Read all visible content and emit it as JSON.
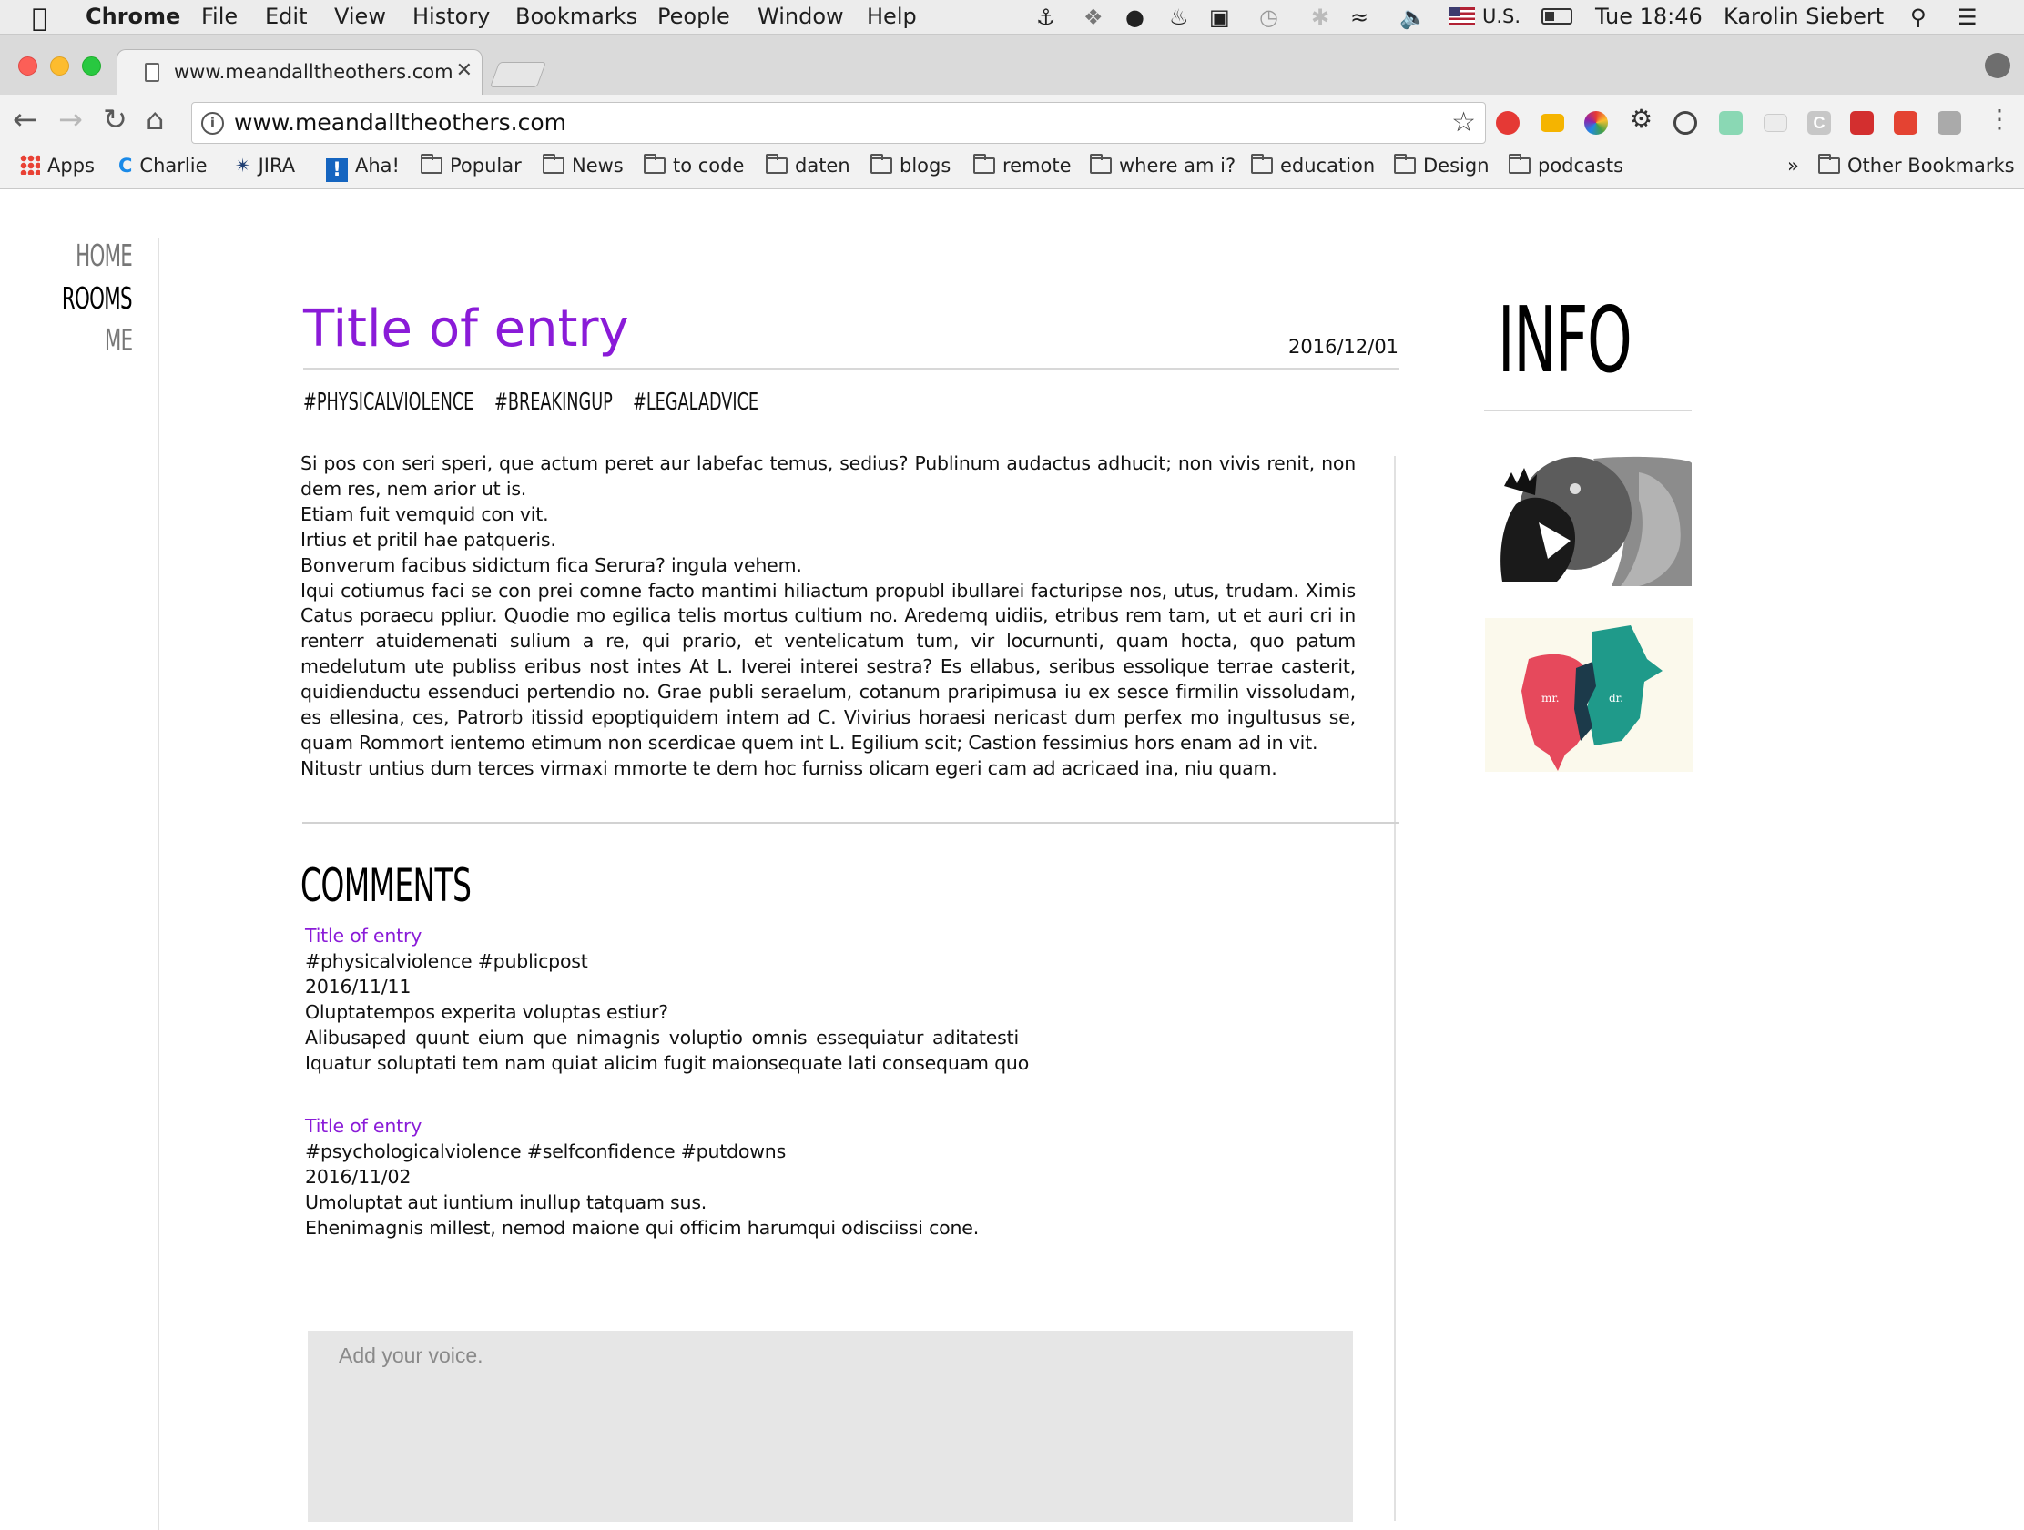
{
  "menubar": {
    "app_name": "Chrome",
    "menus": [
      "File",
      "Edit",
      "View",
      "History",
      "Bookmarks",
      "People",
      "Window",
      "Help"
    ],
    "input_source": "U.S.",
    "clock": "Tue 18:46",
    "user": "Karolin Siebert",
    "status_icons": [
      "docker-icon",
      "dropbox-icon",
      "evernote-icon",
      "flame-icon",
      "display-icon",
      "time-machine-icon",
      "bluetooth-icon",
      "wifi-icon",
      "volume-icon",
      "flag-icon",
      "battery-icon"
    ]
  },
  "browser": {
    "tab_title": "www.meandalltheothers.com",
    "url": "www.meandalltheothers.com",
    "extensions": [
      "adblock-icon",
      "keyboard-maestro-icon",
      "color-picker-icon",
      "gear-icon",
      "sync-icon",
      "sound-icon",
      "blank-icon",
      "c-icon",
      "lastpass-icon",
      "todoist-icon",
      "camera-icon"
    ]
  },
  "bookmarks": {
    "items": [
      {
        "label": "Apps",
        "icon": "apps-grid-icon"
      },
      {
        "label": "Charlie",
        "icon": "charlie-icon"
      },
      {
        "label": "JIRA",
        "icon": "jira-icon"
      },
      {
        "label": "Aha!",
        "icon": "aha-icon"
      },
      {
        "label": "Popular",
        "icon": "folder-icon"
      },
      {
        "label": "News",
        "icon": "folder-icon"
      },
      {
        "label": "to code",
        "icon": "folder-icon"
      },
      {
        "label": "daten",
        "icon": "folder-icon"
      },
      {
        "label": "blogs",
        "icon": "folder-icon"
      },
      {
        "label": "remote",
        "icon": "folder-icon"
      },
      {
        "label": "where am i?",
        "icon": "folder-icon"
      },
      {
        "label": "education",
        "icon": "folder-icon"
      },
      {
        "label": "Design",
        "icon": "folder-icon"
      },
      {
        "label": "podcasts",
        "icon": "folder-icon"
      }
    ],
    "overflow": "»",
    "other": "Other Bookmarks"
  },
  "nav": {
    "home": "HOME",
    "rooms": "ROOMS",
    "me": "ME"
  },
  "entry": {
    "title": "Title of entry",
    "date": "2016/12/01",
    "tags": [
      "#PHYSICALVIOLENCE",
      "#BREAKINGUP",
      "#LEGALADVICE"
    ],
    "paragraphs": [
      "Si pos con seri speri, que actum peret aur labefac temus, sedius? Publinum audactus adhucit; non vivis renit, non dem res, nem arior ut is.",
      "Etiam fuit vemquid con vit.",
      "Irtius et pritil hae patqueris.",
      "Bonverum facibus sidictum fica Serura? ingula vehem.",
      "Iqui cotiumus faci se con prei comne facto mantimi hiliactum propubl ibullarei facturipse nos, utus, trudam. Ximis Catus poraecu ppliur. Quodie mo egilica telis mortus cultium no. Aredemq uidiis, etribus rem tam, ut et auri cri in renterr atuidemenati sulium a re, qui prario, et ventelicatum tum, vir locurnunti, quam hocta, quo patum medelutum ute publiss eribus nost intes At L. Iverei interei sestra? Es ellabus, seribus essolique terrae casterit, quidienductu essenduci pertendio no. Grae publi seraelum, cotanum praripimusa iu ex sesce firmilin vissoludam, es ellesina, ces, Patrorb itissid epoptiquidem intem ad C. Vivirius horaesi nericast dum perfex mo ingultusus se, quam Rommort ientemo etimum non scerdicae quem int L. Egilium scit; Castion fessimius hors enam ad in vit.",
      "Nitustr untius dum terces virmaxi mmorte te dem hoc furniss olicam egeri cam ad acricaed ina, niu quam."
    ]
  },
  "comments": {
    "heading": "COMMENTS",
    "items": [
      {
        "title": "Title of entry",
        "tags": "#physicalviolence #publicpost",
        "date": "2016/11/11",
        "lines": [
          "Oluptatempos experita voluptas estiur?",
          "Alibusaped quunt eium que nimagnis voluptio omnis essequiatur aditatesti",
          "Iquatur soluptati tem nam quiat alicim fugit maionsequate lati consequam quo"
        ]
      },
      {
        "title": "Title of entry",
        "tags": "#psychologicalviolence #selfconfidence #putdowns",
        "date": "2016/11/02",
        "lines": [
          "Umoluptat aut iuntium inullup tatquam sus.",
          "Ehenimagnis millest, nemod maione qui officim harumqui odisciissi cone."
        ]
      }
    ],
    "input_placeholder": "Add your voice.",
    "input_value": ""
  },
  "sidebar": {
    "heading": "INFO",
    "thumbs": [
      {
        "icon": "monsters-illustration"
      },
      {
        "icon": "faces-illustration",
        "labels": [
          "mr.",
          "dr."
        ]
      }
    ]
  },
  "colors": {
    "accent": "#8a1bd8",
    "page_bg": "#ffffff",
    "input_bg": "#e6e6e6",
    "nav_muted": "#777777"
  }
}
